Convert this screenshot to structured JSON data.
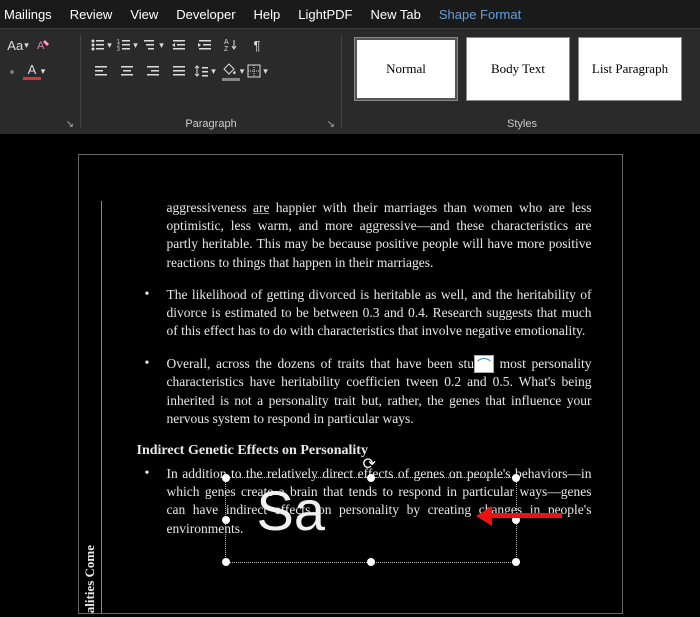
{
  "menu": {
    "items": [
      "Mailings",
      "Review",
      "View",
      "Developer",
      "Help",
      "LightPDF",
      "New Tab"
    ],
    "active": "Shape Format"
  },
  "ribbon": {
    "font_group_label": "",
    "paragraph_group_label": "Paragraph",
    "styles_group_label": "Styles",
    "styles": [
      {
        "label": "Normal",
        "selected": true
      },
      {
        "label": "Body Text",
        "selected": false
      },
      {
        "label": "List Paragraph",
        "selected": false
      }
    ]
  },
  "doc": {
    "p1_pre": "aggressiveness ",
    "p1_are": "are",
    "p1_post": " happier with their marriages than women who are less optimistic, less warm, and more aggressive—and these characteristics are partly heritable. This may be because positive people will have more positive reactions to things that happen in their marriages.",
    "p2": "The likelihood of getting divorced is heritable as well, and the heritability of divorce is estimated to be between 0.3 and 0.4. Research suggests that much of this effect has to do with characteristics that involve negative emotionality.",
    "p3a": "Overall, across the dozens of traits that have been stu",
    "p3b": " most personality characteristics have heritability coefficien",
    "p3c": "tween 0.2 and 0.5. What's being inherited is not a personality trait but, rather, the genes that influence your nervous system to respond in particular ways.",
    "heading": "Indirect Genetic Effects on Personality",
    "p4": "In addition to the relatively direct effects of genes on people's behaviors—in which genes create a brain that tends to respond in particular ways—genes can have indirect effects on personality by creating changes in people's environments.",
    "sidelabel": "alities Come",
    "shape_text": "Sa",
    "picture_glyph": "⌒"
  }
}
